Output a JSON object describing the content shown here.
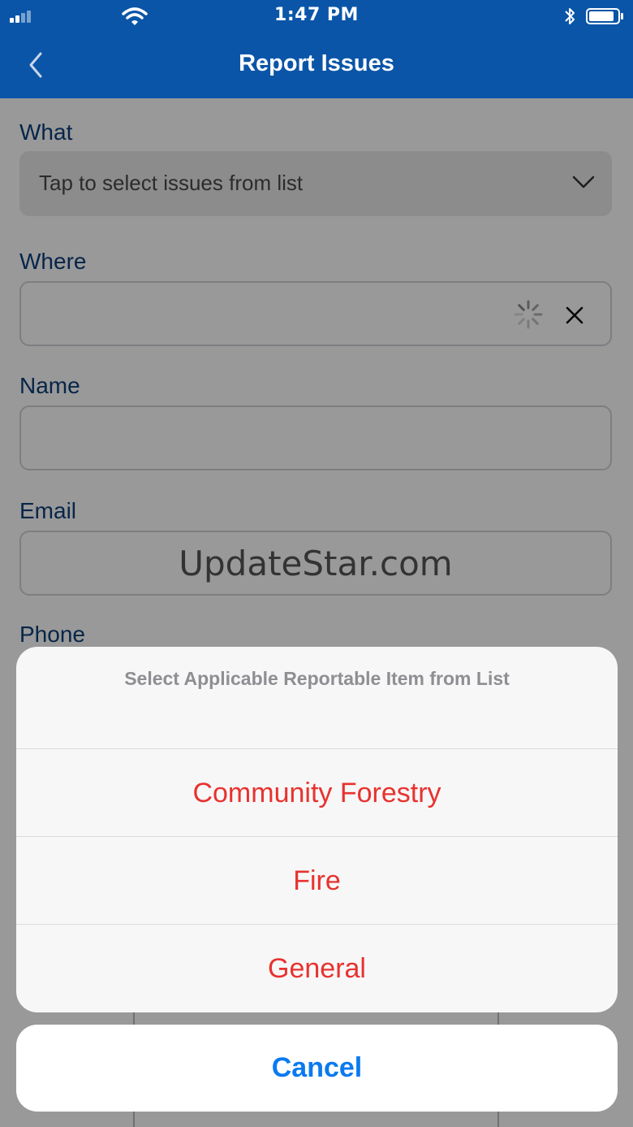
{
  "status_bar": {
    "time": "1:47 PM",
    "icons": [
      "signal-icon",
      "wifi-icon",
      "bluetooth-icon",
      "battery-icon"
    ]
  },
  "nav": {
    "title": "Report Issues",
    "back_icon": "chevron-left-icon"
  },
  "form": {
    "what": {
      "label": "What",
      "placeholder": "Tap to select issues from list",
      "icon": "chevron-down-icon"
    },
    "where": {
      "label": "Where",
      "icons": [
        "spinner-icon",
        "clear-icon"
      ]
    },
    "name": {
      "label": "Name"
    },
    "email": {
      "label": "Email",
      "watermark": "UpdateStar.com"
    },
    "phone": {
      "label": "Phone"
    }
  },
  "action_sheet": {
    "title": "Select Applicable Reportable Item from List",
    "options": [
      {
        "label": "Community Forestry"
      },
      {
        "label": "Fire"
      },
      {
        "label": "General"
      }
    ],
    "cancel_label": "Cancel"
  },
  "colors": {
    "nav_background": "#0a55a8",
    "label_text": "#0d3f7a",
    "option_text": "#e8322f",
    "cancel_text": "#0a7af0"
  }
}
